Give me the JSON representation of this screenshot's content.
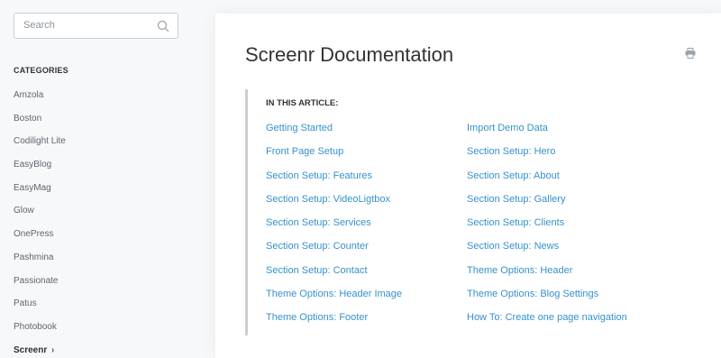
{
  "search": {
    "placeholder": "Search"
  },
  "sidebar": {
    "heading": "CATEGORIES",
    "items": [
      {
        "label": "Amzola"
      },
      {
        "label": "Boston"
      },
      {
        "label": "Codilight Lite"
      },
      {
        "label": "EasyBlog"
      },
      {
        "label": "EasyMag"
      },
      {
        "label": "Glow"
      },
      {
        "label": "OnePress"
      },
      {
        "label": "Pashmina"
      },
      {
        "label": "Passionate"
      },
      {
        "label": "Patus"
      },
      {
        "label": "Photobook"
      },
      {
        "label": "Screenr",
        "active": true,
        "chevron": "›"
      }
    ]
  },
  "article": {
    "title": "Screenr Documentation",
    "toc_heading": "IN THIS ARTICLE:",
    "toc_left": [
      "Getting Started",
      "Front Page Setup",
      "Section Setup: Features",
      "Section Setup: VideoLigtbox",
      "Section Setup: Services",
      "Section Setup: Counter",
      "Section Setup: Contact",
      "Theme Options: Header Image",
      "Theme Options: Footer"
    ],
    "toc_right": [
      "Import Demo Data",
      "Section Setup: Hero",
      "Section Setup: About",
      "Section Setup: Gallery",
      "Section Setup: Clients",
      "Section Setup: News",
      "Theme Options: Header",
      "Theme Options: Blog Settings",
      "How To: Create one page navigation"
    ]
  },
  "icons": {
    "search": "search-icon",
    "print": "print-icon"
  },
  "colors": {
    "link": "#3691cb",
    "background": "#f7f8f9",
    "toc_border": "#c9cfd4"
  }
}
